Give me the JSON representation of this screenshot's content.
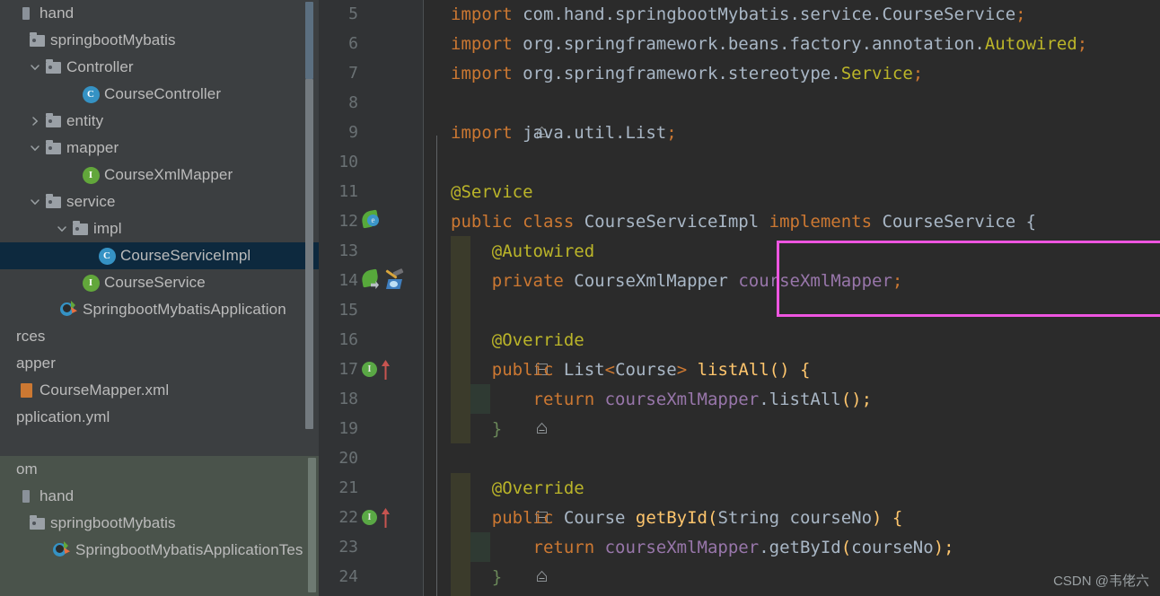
{
  "sidebar": {
    "vertical_scrollbar": "scrollbar",
    "tree_upper": [
      {
        "label": "hand",
        "icon": "module-square-icon",
        "indent": 0,
        "twisty": "none",
        "kind": "module",
        "clipped_left": true,
        "selected": false
      },
      {
        "label": "springbootMybatis",
        "icon": "folder-icon",
        "indent": 12,
        "twisty": "none",
        "kind": "folder",
        "clipped_left": false,
        "selected": false
      },
      {
        "label": "Controller",
        "icon": "folder-icon",
        "indent": 30,
        "twisty": "expanded",
        "kind": "folder",
        "clipped_left": false,
        "selected": false
      },
      {
        "label": "CourseController",
        "icon": "class-icon",
        "indent": 72,
        "twisty": "none",
        "kind": "class",
        "clipped_left": false,
        "selected": false
      },
      {
        "label": "entity",
        "icon": "folder-icon",
        "indent": 30,
        "twisty": "collapsed",
        "kind": "folder",
        "clipped_left": false,
        "selected": false
      },
      {
        "label": "mapper",
        "icon": "folder-icon",
        "indent": 30,
        "twisty": "expanded",
        "kind": "folder",
        "clipped_left": false,
        "selected": false
      },
      {
        "label": "CourseXmlMapper",
        "icon": "interface-icon",
        "indent": 72,
        "twisty": "none",
        "kind": "interface",
        "clipped_left": false,
        "selected": false
      },
      {
        "label": "service",
        "icon": "folder-icon",
        "indent": 30,
        "twisty": "expanded",
        "kind": "folder",
        "clipped_left": false,
        "selected": false
      },
      {
        "label": "impl",
        "icon": "folder-icon",
        "indent": 60,
        "twisty": "expanded",
        "kind": "folder",
        "clipped_left": false,
        "selected": false
      },
      {
        "label": "CourseServiceImpl",
        "icon": "class-icon",
        "indent": 90,
        "twisty": "none",
        "kind": "class",
        "clipped_left": false,
        "selected": true
      },
      {
        "label": "CourseService",
        "icon": "interface-icon",
        "indent": 72,
        "twisty": "none",
        "kind": "interface",
        "clipped_left": false,
        "selected": false
      },
      {
        "label": "SpringbootMybatisApplication",
        "icon": "spring-boot-icon",
        "indent": 48,
        "twisty": "none",
        "kind": "spring",
        "clipped_left": false,
        "selected": false
      },
      {
        "label": "rces",
        "icon": "none",
        "indent": 0,
        "twisty": "none",
        "kind": "text",
        "clipped_left": true,
        "selected": false
      },
      {
        "label": "apper",
        "icon": "none",
        "indent": 0,
        "twisty": "none",
        "kind": "text",
        "clipped_left": true,
        "selected": false
      },
      {
        "label": "CourseMapper.xml",
        "icon": "xml-file-icon",
        "indent": 0,
        "twisty": "none",
        "kind": "xml",
        "clipped_left": true,
        "selected": false
      },
      {
        "label": "pplication.yml",
        "icon": "none",
        "indent": 0,
        "twisty": "none",
        "kind": "text",
        "clipped_left": true,
        "selected": false
      }
    ],
    "tree_lower": [
      {
        "label": "om",
        "icon": "none",
        "indent": 0,
        "twisty": "none",
        "kind": "text",
        "clipped_left": true,
        "selected": false
      },
      {
        "label": "hand",
        "icon": "module-square-icon",
        "indent": 0,
        "twisty": "none",
        "kind": "module",
        "clipped_left": true,
        "selected": false
      },
      {
        "label": "springbootMybatis",
        "icon": "folder-icon",
        "indent": 12,
        "twisty": "none",
        "kind": "folder",
        "clipped_left": false,
        "selected": false
      },
      {
        "label": "SpringbootMybatisApplicationTes",
        "icon": "test-class-icon",
        "indent": 40,
        "twisty": "none",
        "kind": "test",
        "clipped_left": false,
        "selected": false
      }
    ]
  },
  "editor": {
    "first_visible_line": 5,
    "lines": [
      {
        "num": "5",
        "indent": 0,
        "markers": [],
        "fold": "none",
        "segments": [
          {
            "t": "import ",
            "c": "kw"
          },
          {
            "t": "com.hand.springbootMybatis.service.CourseService",
            "c": "typ"
          },
          {
            "t": ";",
            "c": "pun"
          }
        ]
      },
      {
        "num": "6",
        "indent": 0,
        "markers": [],
        "fold": "none",
        "segments": [
          {
            "t": "import ",
            "c": "kw"
          },
          {
            "t": "org.springframework.beans.factory.annotation.",
            "c": "typ"
          },
          {
            "t": "Autowired",
            "c": "ann"
          },
          {
            "t": ";",
            "c": "pun"
          }
        ]
      },
      {
        "num": "7",
        "indent": 0,
        "markers": [],
        "fold": "none",
        "segments": [
          {
            "t": "import ",
            "c": "kw"
          },
          {
            "t": "org.springframework.stereotype.",
            "c": "typ"
          },
          {
            "t": "Service",
            "c": "ann"
          },
          {
            "t": ";",
            "c": "pun"
          }
        ]
      },
      {
        "num": "8",
        "indent": 0,
        "markers": [],
        "fold": "none",
        "segments": []
      },
      {
        "num": "9",
        "indent": 0,
        "markers": [],
        "fold": "collapse-top",
        "segments": [
          {
            "t": "import ",
            "c": "kw"
          },
          {
            "t": "java.util.List",
            "c": "typ"
          },
          {
            "t": ";",
            "c": "pun"
          }
        ]
      },
      {
        "num": "10",
        "indent": 0,
        "markers": [],
        "fold": "none",
        "segments": []
      },
      {
        "num": "11",
        "indent": 0,
        "markers": [],
        "fold": "none",
        "segments": [
          {
            "t": "@Service",
            "c": "ann"
          }
        ]
      },
      {
        "num": "12",
        "indent": 0,
        "markers": [
          "spring-bean-icon"
        ],
        "fold": "none",
        "segments": [
          {
            "t": "public class ",
            "c": "kw"
          },
          {
            "t": "CourseServiceImpl ",
            "c": "typ"
          },
          {
            "t": "implements ",
            "c": "kw"
          },
          {
            "t": "CourseService",
            "c": "typ"
          },
          {
            "t": " {",
            "c": "typ"
          }
        ]
      },
      {
        "num": "13",
        "indent": 1,
        "markers": [],
        "fold": "none",
        "segments": [
          {
            "t": "    @Autowired",
            "c": "ann"
          }
        ]
      },
      {
        "num": "14",
        "indent": 1,
        "markers": [
          "spring-autowire-icon",
          "hammer-tool-icon"
        ],
        "fold": "none",
        "segments": [
          {
            "t": "    ",
            "c": "typ"
          },
          {
            "t": "private ",
            "c": "kw"
          },
          {
            "t": "CourseXmlMapper ",
            "c": "typ"
          },
          {
            "t": "courseXmlMapper",
            "c": "fld"
          },
          {
            "t": ";",
            "c": "pun"
          }
        ]
      },
      {
        "num": "15",
        "indent": 1,
        "markers": [],
        "fold": "none",
        "segments": []
      },
      {
        "num": "16",
        "indent": 1,
        "markers": [],
        "fold": "none",
        "segments": [
          {
            "t": "    @Override",
            "c": "ann"
          }
        ]
      },
      {
        "num": "17",
        "indent": 1,
        "markers": [
          "implements-method-icon"
        ],
        "fold": "open",
        "segments": [
          {
            "t": "    ",
            "c": "typ"
          },
          {
            "t": "public ",
            "c": "kw"
          },
          {
            "t": "List",
            "c": "typ"
          },
          {
            "t": "<",
            "c": "pun"
          },
          {
            "t": "Course",
            "c": "typ"
          },
          {
            "t": "> ",
            "c": "pun"
          },
          {
            "t": "listAll",
            "c": "mth"
          },
          {
            "t": "() {",
            "c": "mth"
          }
        ]
      },
      {
        "num": "18",
        "indent": 2,
        "markers": [],
        "fold": "none",
        "segments": [
          {
            "t": "        ",
            "c": "typ"
          },
          {
            "t": "return ",
            "c": "kw"
          },
          {
            "t": "courseXmlMapper",
            "c": "fld"
          },
          {
            "t": ".",
            "c": "typ"
          },
          {
            "t": "listAll",
            "c": "typ"
          },
          {
            "t": "();",
            "c": "mth"
          }
        ]
      },
      {
        "num": "19",
        "indent": 1,
        "markers": [],
        "fold": "close",
        "segments": [
          {
            "t": "    }",
            "c": "grn"
          }
        ]
      },
      {
        "num": "20",
        "indent": 0,
        "markers": [],
        "fold": "none",
        "segments": []
      },
      {
        "num": "21",
        "indent": 1,
        "markers": [],
        "fold": "none",
        "segments": [
          {
            "t": "    @Override",
            "c": "ann"
          }
        ]
      },
      {
        "num": "22",
        "indent": 1,
        "markers": [
          "implements-method-icon"
        ],
        "fold": "open",
        "segments": [
          {
            "t": "    ",
            "c": "typ"
          },
          {
            "t": "public ",
            "c": "kw"
          },
          {
            "t": "Course ",
            "c": "typ"
          },
          {
            "t": "getById",
            "c": "mth"
          },
          {
            "t": "(",
            "c": "mth"
          },
          {
            "t": "String ",
            "c": "typ"
          },
          {
            "t": "courseNo",
            "c": "typ"
          },
          {
            "t": ") {",
            "c": "mth"
          }
        ]
      },
      {
        "num": "23",
        "indent": 2,
        "markers": [],
        "fold": "none",
        "segments": [
          {
            "t": "        ",
            "c": "typ"
          },
          {
            "t": "return ",
            "c": "kw"
          },
          {
            "t": "courseXmlMapper",
            "c": "fld"
          },
          {
            "t": ".",
            "c": "typ"
          },
          {
            "t": "getById",
            "c": "typ"
          },
          {
            "t": "(",
            "c": "mth"
          },
          {
            "t": "courseNo",
            "c": "typ"
          },
          {
            "t": ");",
            "c": "mth"
          }
        ]
      },
      {
        "num": "24",
        "indent": 1,
        "markers": [],
        "fold": "close",
        "segments": [
          {
            "t": "    }",
            "c": "grn"
          }
        ]
      }
    ],
    "annotation_box": {
      "color": "#ee55e0",
      "encloses_lines": [
        "13",
        "14"
      ]
    }
  },
  "watermark": {
    "text": "CSDN @韦佬六"
  },
  "colors": {
    "editor_bg": "#2b2b2b",
    "gutter_bg": "#313335",
    "sidebar_bg": "#3c3f41",
    "sidebar_lower_bg": "#4a534b",
    "selection_bg": "#0d293e",
    "keyword": "#cc7832",
    "annotation": "#bbb529",
    "identifier": "#a9b7c6",
    "field": "#9876aa",
    "method": "#ffc66d",
    "brace_green": "#6a8759",
    "accent_magenta": "#ee55e0",
    "indent_highlight": "#3b3b2b",
    "line_number": "#6a7174"
  }
}
